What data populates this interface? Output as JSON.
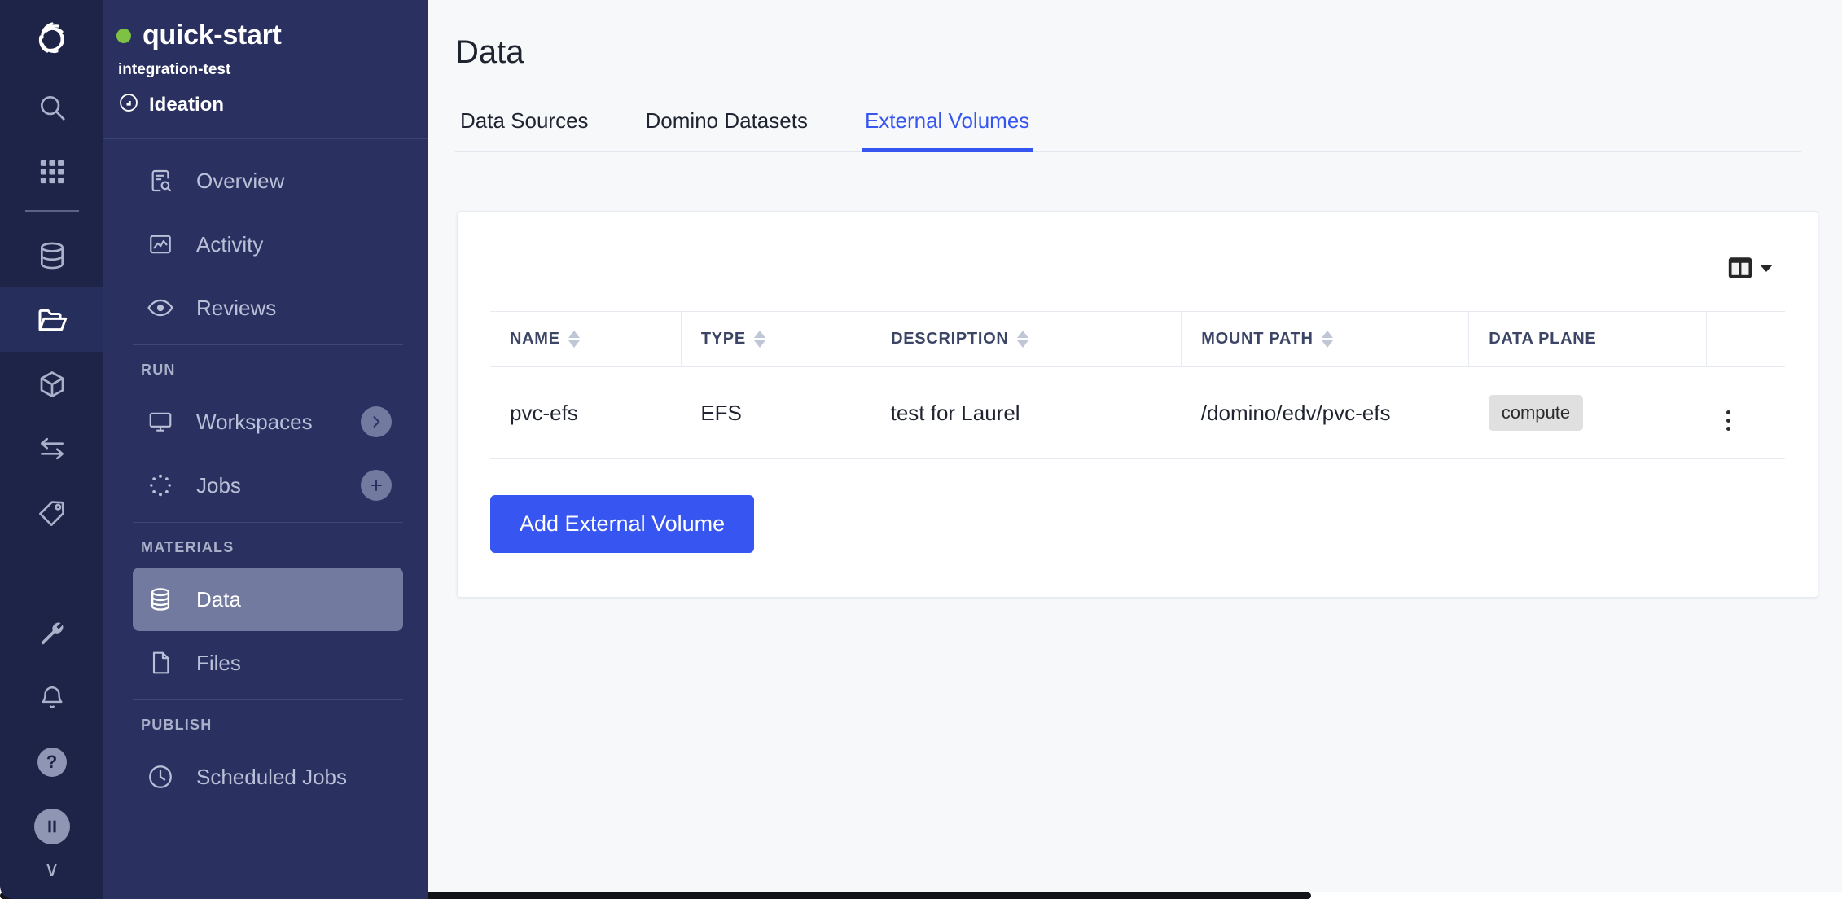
{
  "rail": {
    "logo_icon": "domino-logo-icon",
    "items": [
      {
        "icon": "search-icon",
        "name": "search",
        "active": false
      },
      {
        "icon": "grid-apps-icon",
        "name": "apps",
        "active": false
      },
      {
        "icon": "database-icon",
        "name": "data",
        "active": false
      },
      {
        "icon": "folder-open-icon",
        "name": "projects",
        "active": true
      },
      {
        "icon": "cube-icon",
        "name": "environments",
        "active": false
      },
      {
        "icon": "transfer-arrows-icon",
        "name": "transfers",
        "active": false
      },
      {
        "icon": "tag-icon",
        "name": "tags",
        "active": false
      }
    ],
    "bottom_items": [
      {
        "icon": "wrench-icon",
        "name": "admin"
      },
      {
        "icon": "bell-icon",
        "name": "notifications"
      },
      {
        "icon": "question-mark-icon",
        "name": "help",
        "glyph": "?"
      },
      {
        "icon": "pause-icon",
        "name": "user-avatar",
        "glyph": "II"
      },
      {
        "icon": "chevron-down-icon",
        "name": "collapse",
        "glyph": "∨"
      }
    ]
  },
  "sidebar": {
    "project_name": "quick-start",
    "owner": "integration-test",
    "stage": "Ideation",
    "stage_icon": "stage-ideation-icon",
    "status_color": "#7dc242",
    "top_items": [
      {
        "label": "Overview",
        "icon": "document-search-icon"
      },
      {
        "label": "Activity",
        "icon": "activity-chart-icon"
      },
      {
        "label": "Reviews",
        "icon": "eye-icon"
      }
    ],
    "groups": [
      {
        "title": "RUN",
        "items": [
          {
            "label": "Workspaces",
            "icon": "monitor-icon",
            "badge": "chevron-right-icon"
          },
          {
            "label": "Jobs",
            "icon": "jobs-spinner-icon",
            "badge": "plus-icon"
          }
        ]
      },
      {
        "title": "MATERIALS",
        "items": [
          {
            "label": "Data",
            "icon": "database-icon",
            "active": true
          },
          {
            "label": "Files",
            "icon": "file-icon"
          }
        ]
      },
      {
        "title": "PUBLISH",
        "items": [
          {
            "label": "Scheduled Jobs",
            "icon": "clock-icon"
          }
        ]
      }
    ]
  },
  "main": {
    "page_title": "Data",
    "tabs": [
      {
        "label": "Data Sources",
        "active": false
      },
      {
        "label": "Domino Datasets",
        "active": false
      },
      {
        "label": "External Volumes",
        "active": true
      }
    ],
    "accent_color": "#3755f0",
    "toolbar": {
      "column_picker_icon": "columns-layout-icon",
      "column_picker_caret": "caret-down-icon"
    },
    "table": {
      "columns": [
        {
          "label": "NAME",
          "sortable": true
        },
        {
          "label": "TYPE",
          "sortable": true
        },
        {
          "label": "DESCRIPTION",
          "sortable": true
        },
        {
          "label": "MOUNT PATH",
          "sortable": true
        },
        {
          "label": "DATA PLANE",
          "sortable": false
        }
      ],
      "rows": [
        {
          "name": "pvc-efs",
          "type": "EFS",
          "description": "test for Laurel",
          "mount_path": "/domino/edv/pvc-efs",
          "data_plane": "compute",
          "actions_icon": "kebab-menu-icon"
        }
      ]
    },
    "add_button_label": "Add External Volume"
  }
}
